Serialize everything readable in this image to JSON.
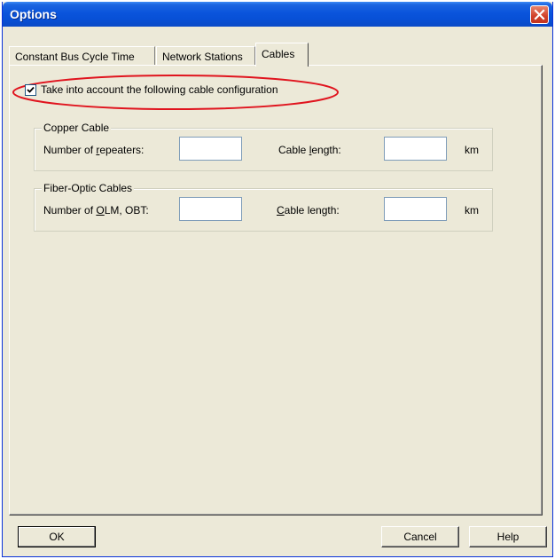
{
  "window": {
    "title": "Options"
  },
  "tabs": [
    {
      "label": "Constant Bus Cycle Time"
    },
    {
      "label": "Network Stations"
    },
    {
      "label": "Cables",
      "active": true
    }
  ],
  "cable_config": {
    "checkbox_label": "Take into account the following cable configuration",
    "checked": true
  },
  "copper": {
    "title": "Copper Cable",
    "repeaters_label_pre": "Number of ",
    "repeaters_label_key": "r",
    "repeaters_label_post": "epeaters:",
    "repeaters_value": "",
    "length_label_pre": "Cable ",
    "length_label_key": "l",
    "length_label_post": "ength:",
    "length_value": "",
    "unit": "km"
  },
  "fiber": {
    "title": "Fiber-Optic Cables",
    "olm_label_pre": "Number of ",
    "olm_label_key": "O",
    "olm_label_post": "LM, OBT:",
    "olm_value": "",
    "length_label_key": "C",
    "length_label_post": "able length:",
    "length_value": "",
    "unit": "km"
  },
  "buttons": {
    "ok": "OK",
    "cancel": "Cancel",
    "help": "Help"
  },
  "colors": {
    "titlebar": "#0a54dc",
    "highlight": "#e0141e",
    "face": "#ece9d8"
  }
}
